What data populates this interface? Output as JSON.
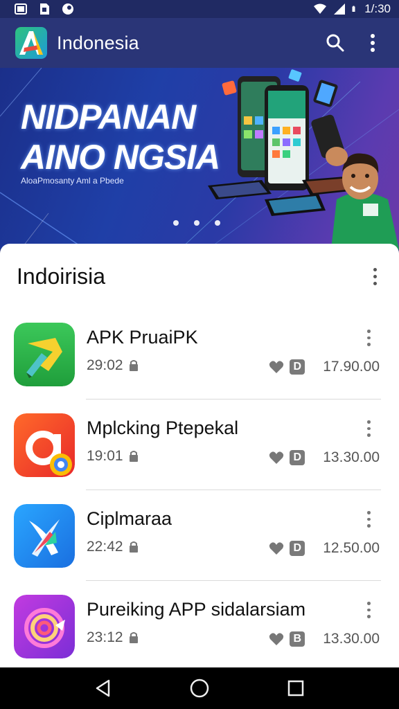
{
  "status_bar": {
    "time": "1/:30",
    "icons": [
      "gallery-icon",
      "sim-icon",
      "notification-icon",
      "wifi-icon",
      "signal-icon",
      "battery-icon"
    ]
  },
  "app_bar": {
    "title": "Indonesia",
    "logo_icon": "app-logo-a-icon",
    "actions": [
      "search-icon",
      "more-vert-icon"
    ]
  },
  "banner": {
    "title_line1": "NIDPANAN",
    "title_line2": "AINO NGSIA",
    "subtitle": "AloaPmosanty Aml a Pbede",
    "page_indicator": {
      "count": 3
    }
  },
  "section": {
    "title": "Indoirisia"
  },
  "apps": [
    {
      "name": "APK PruaiPK",
      "time": "29:02",
      "badge": "D",
      "size": "17.90.00",
      "icon": "green-pen-app-icon",
      "color": "#2fb84a"
    },
    {
      "name": "Mplcking Ptepekal",
      "time": "19:01",
      "badge": "D",
      "size": "13.30.00",
      "icon": "orange-a-app-icon",
      "color": "#f2482a"
    },
    {
      "name": "Ciplmaraa",
      "time": "22:42",
      "badge": "D",
      "size": "12.50.00",
      "icon": "blue-feather-app-icon",
      "color": "#1f8ef0"
    },
    {
      "name": "Pureiking APP sidalarsiam",
      "time": "23:12",
      "badge": "B",
      "size": "13.30.00",
      "icon": "purple-swirl-app-icon",
      "color": "#a23ad6"
    }
  ],
  "nav_bar": {
    "buttons": [
      "back-icon",
      "home-icon",
      "recents-icon"
    ]
  },
  "colors": {
    "app_bar": "#2a3577",
    "status_bar": "#202a63",
    "card": "#ffffff",
    "divider": "#dadada"
  }
}
